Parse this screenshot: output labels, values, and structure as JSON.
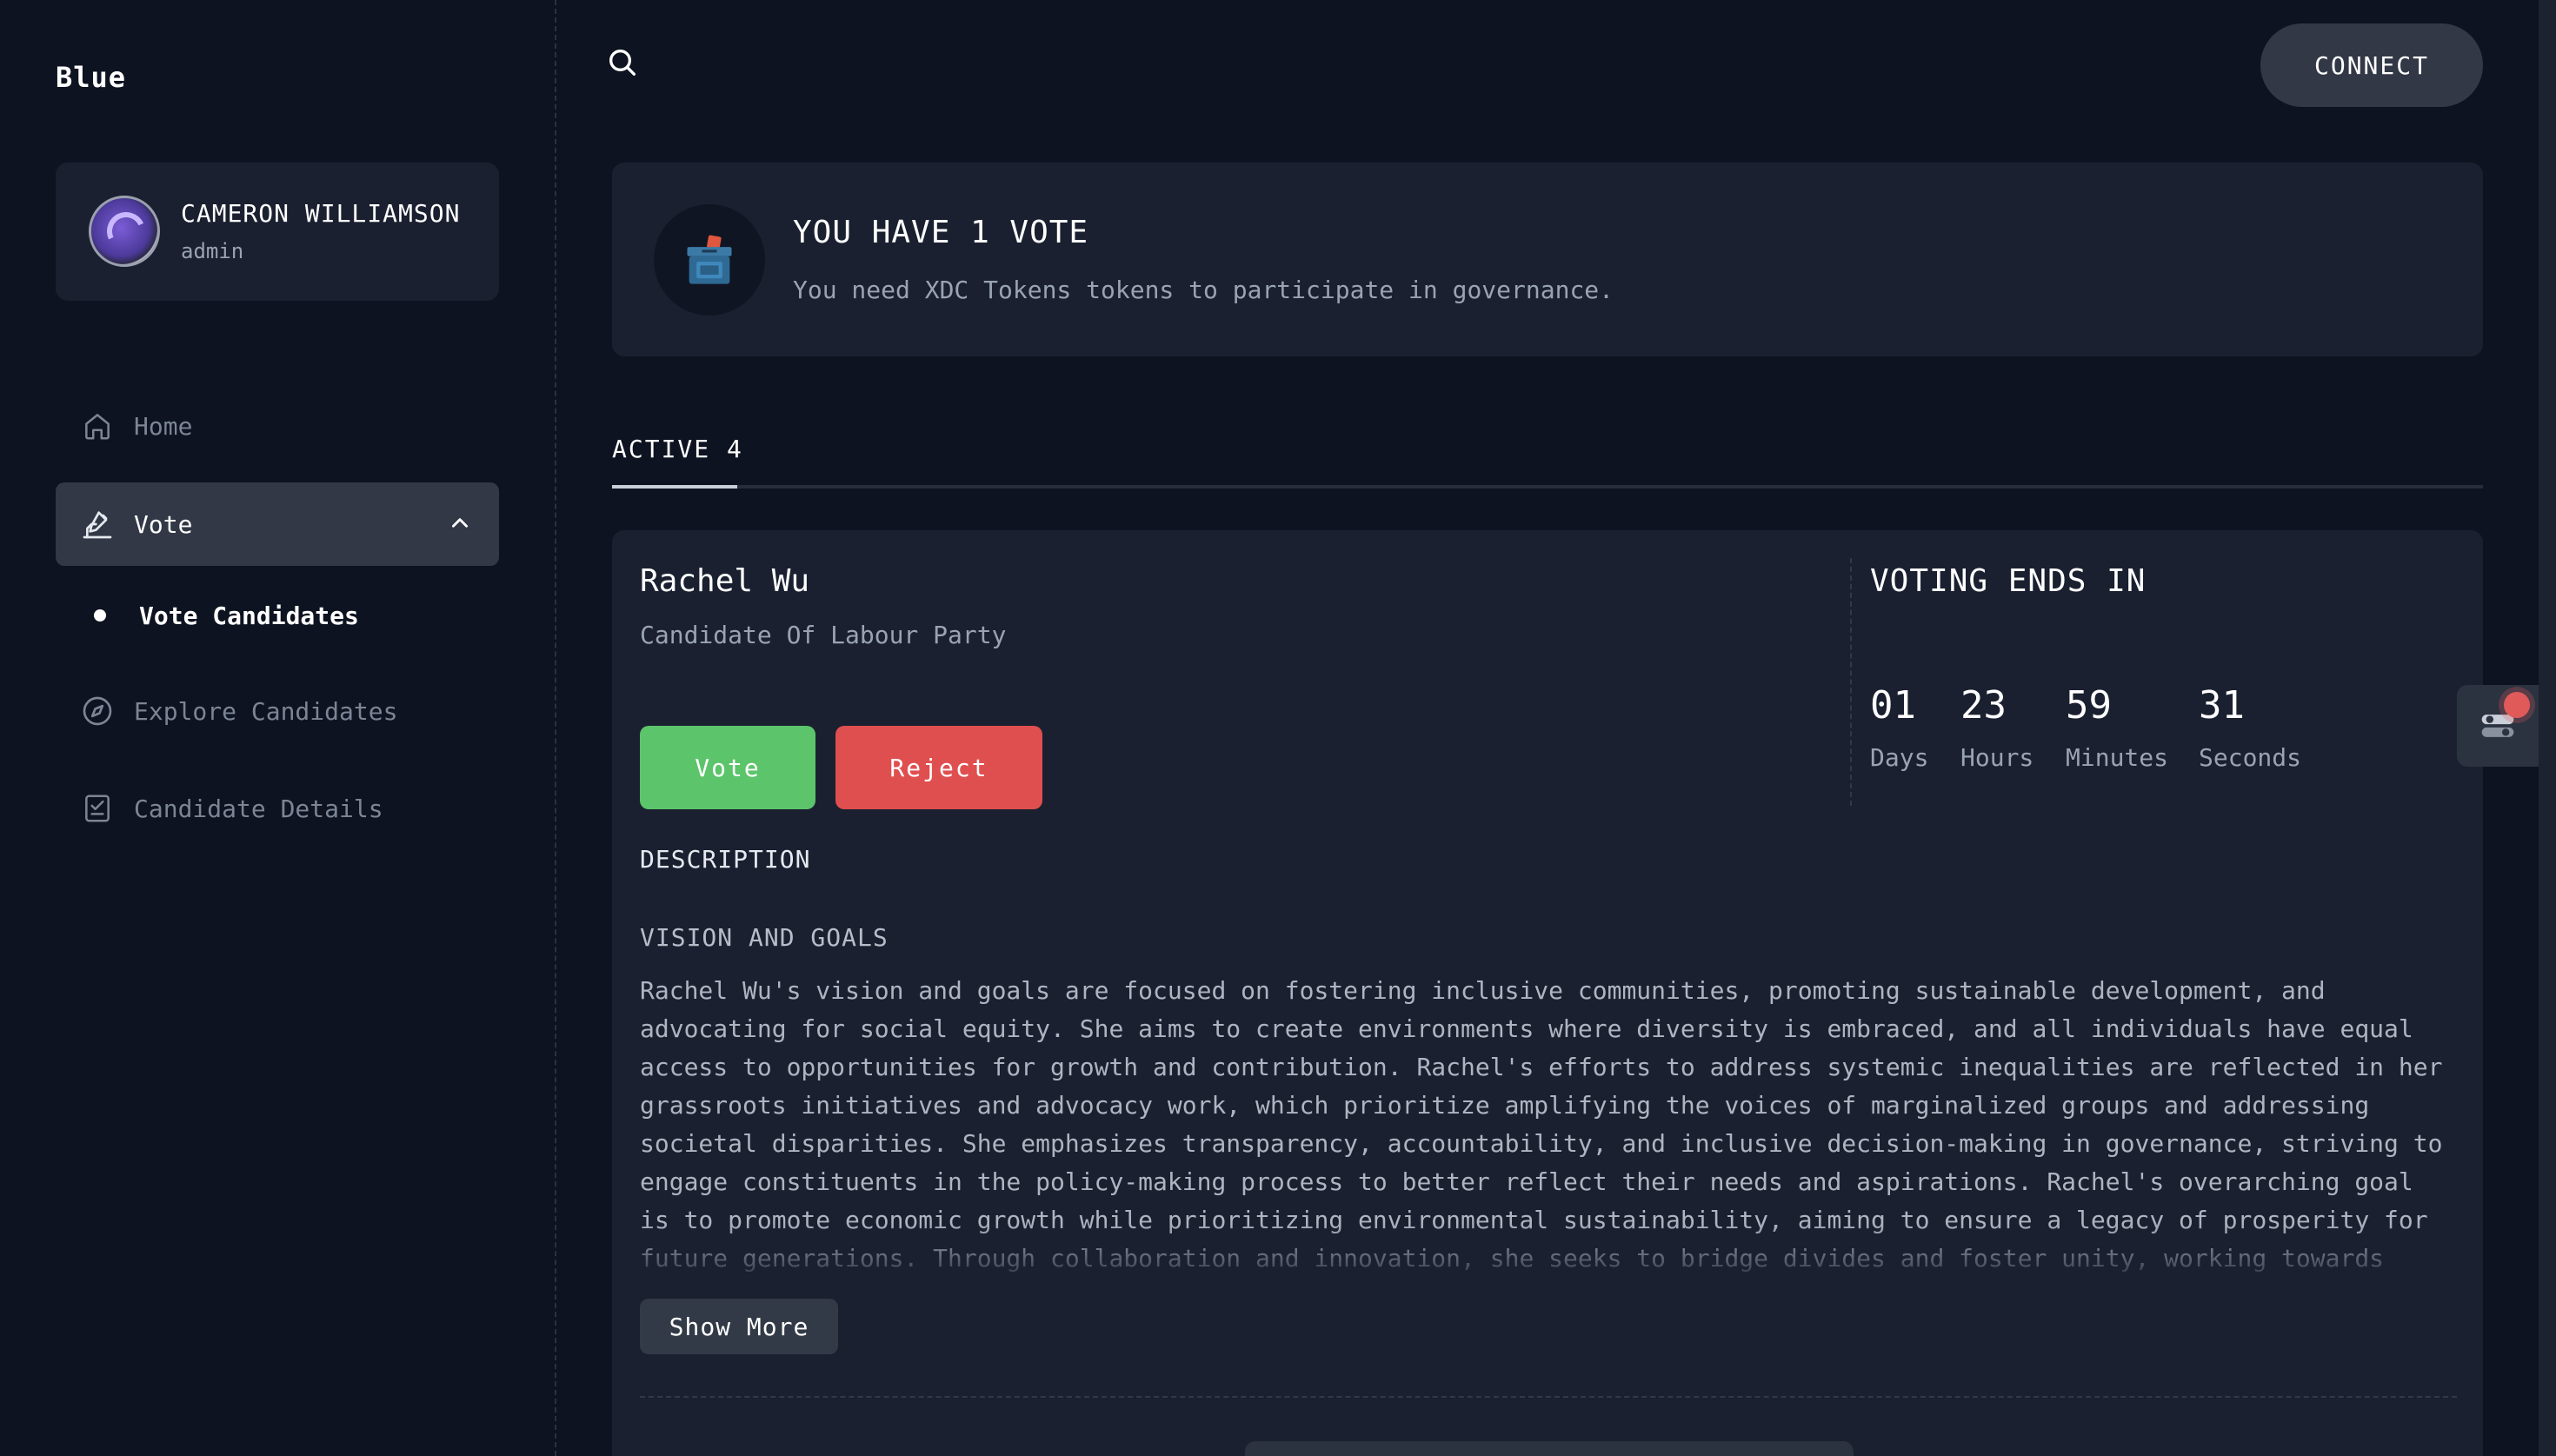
{
  "brand": "Blue",
  "user": {
    "name": "CAMERON WILLIAMSON",
    "role": "admin"
  },
  "sidebar": {
    "items": [
      {
        "label": "Home",
        "icon": "home-icon"
      },
      {
        "label": "Vote",
        "icon": "vote-icon",
        "expanded": true
      },
      {
        "label": "Vote Candidates",
        "active": true
      },
      {
        "label": "Explore Candidates",
        "icon": "compass-icon"
      },
      {
        "label": "Candidate Details",
        "icon": "checklist-icon"
      }
    ]
  },
  "header": {
    "connect_label": "CONNECT",
    "search_icon": "search-icon"
  },
  "banner": {
    "title": "YOU HAVE 1 VOTE",
    "subtitle": "You need XDC Tokens tokens to participate in governance.",
    "icon": "ballot-box-icon"
  },
  "tabs": [
    {
      "label": "ACTIVE 4",
      "active": true
    }
  ],
  "candidate": {
    "name": "Rachel Wu",
    "party": "Candidate Of Labour Party",
    "vote_label": "Vote",
    "reject_label": "Reject",
    "description_heading": "DESCRIPTION",
    "vision_heading": "VISION AND GOALS",
    "vision_text": "Rachel Wu's vision and goals are focused on fostering inclusive communities, promoting sustainable development, and advocating for social equity. She aims to create environments where diversity is embraced, and all individuals have equal access to opportunities for growth and contribution. Rachel's efforts to address systemic inequalities are reflected in her grassroots initiatives and advocacy work, which prioritize amplifying the voices of marginalized groups and addressing societal disparities. She emphasizes transparency, accountability, and inclusive decision-making in governance, striving to engage constituents in the policy-making process to better reflect their needs and aspirations. Rachel's overarching goal is to promote economic growth while prioritizing environmental sustainability, aiming to ensure a legacy of prosperity for future generations. Through collaboration and innovation, she seeks to bridge divides and foster unity, working towards",
    "show_more_label": "Show More"
  },
  "countdown": {
    "title": "VOTING ENDS IN",
    "days": "01",
    "days_label": "Days",
    "hours": "23",
    "hours_label": "Hours",
    "minutes": "59",
    "minutes_label": "Minutes",
    "seconds": "31",
    "seconds_label": "Seconds"
  },
  "colors": {
    "background": "#0d1320",
    "card": "#1a2030",
    "vote_green": "#5cc46a",
    "reject_red": "#e04f4f",
    "notification_red": "#e05a5a"
  }
}
